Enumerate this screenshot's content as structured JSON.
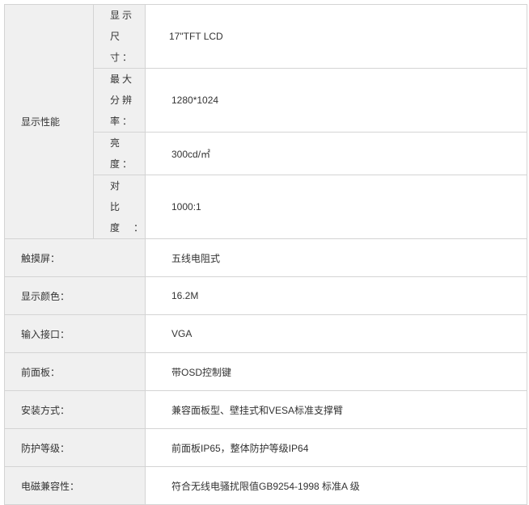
{
  "section": {
    "label": "显示性能",
    "items": [
      {
        "label": "显示尺寸：",
        "value": "17\"TFT  LCD"
      },
      {
        "label": "最大分辨率：",
        "value": "1280*1024"
      },
      {
        "label": "亮度：",
        "value": "300cd/㎡"
      },
      {
        "label": "对比度：",
        "value": "1000:1"
      }
    ]
  },
  "rows": [
    {
      "label": "触摸屏：",
      "value": "五线电阻式"
    },
    {
      "label": "显示颜色：",
      "value": "16.2M"
    },
    {
      "label": "输入接口：",
      "value": "VGA"
    },
    {
      "label": "前面板：",
      "value": "带OSD控制键"
    },
    {
      "label": "安装方式：",
      "value": "兼容面板型、壁挂式和VESA标准支撑臂"
    },
    {
      "label": "防护等级：",
      "value": "前面板IP65，整体防护等级IP64"
    },
    {
      "label": "电磁兼容性：",
      "value": "符合无线电骚扰限值GB9254-1998 标准A 级"
    }
  ]
}
